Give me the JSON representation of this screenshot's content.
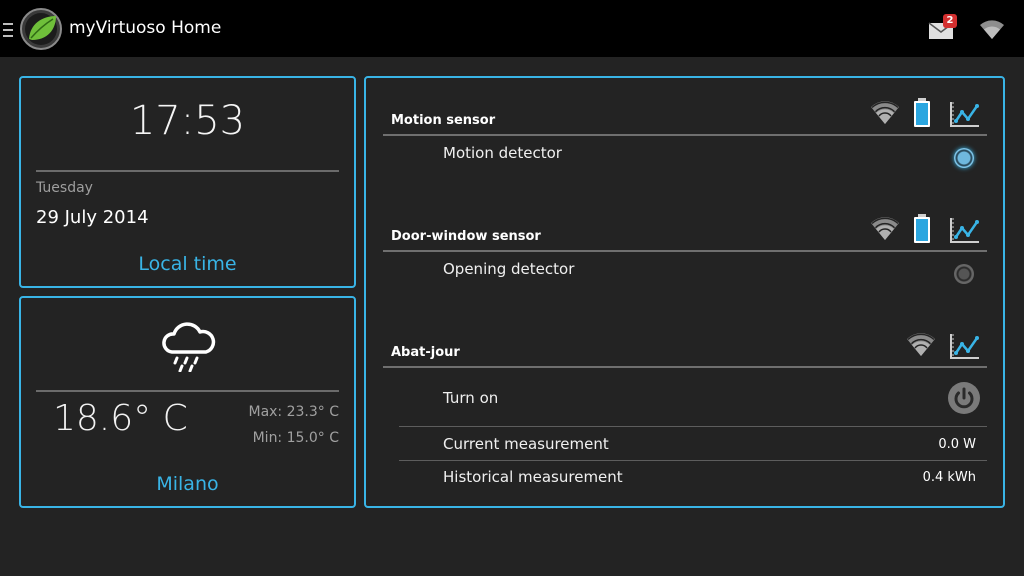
{
  "app": {
    "title": "myVirtuoso Home",
    "notification_count": "2"
  },
  "time_card": {
    "time": "17:53",
    "day": "Tuesday",
    "date": "29 July 2014",
    "link_label": "Local time"
  },
  "weather_card": {
    "icon": "rain-cloud-icon",
    "temperature": "18.6° C",
    "max": "Max: 23.3° C",
    "min": "Min: 15.0° C",
    "city": "Milano"
  },
  "devices": {
    "motion_sensor": {
      "title": "Motion sensor",
      "row_label": "Motion detector",
      "state": "active"
    },
    "door_sensor": {
      "title": "Door-window sensor",
      "row_label": "Opening detector",
      "state": "inactive"
    },
    "abat_jour": {
      "title": "Abat-jour",
      "turn_on_label": "Turn on",
      "current_label": "Current measurement",
      "current_value": "0.0 W",
      "historical_label": "Historical measurement",
      "historical_value": "0.4 kWh"
    }
  },
  "colors": {
    "accent": "#39b4e6",
    "background": "#232323",
    "actionbar": "#000000"
  }
}
